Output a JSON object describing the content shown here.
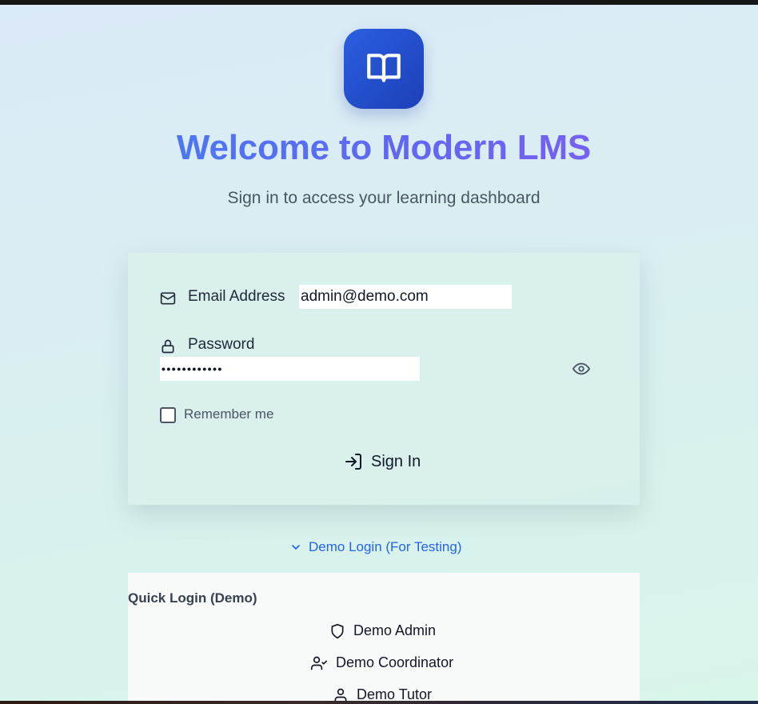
{
  "header": {
    "logo_icon": "book-open-icon",
    "title": "Welcome to Modern LMS",
    "subtitle": "Sign in to access your learning dashboard"
  },
  "form": {
    "email": {
      "icon": "mail-icon",
      "label": "Email Address",
      "value": "admin@demo.com"
    },
    "password": {
      "icon": "lock-icon",
      "label": "Password",
      "value_masked": "••••••••••••",
      "toggle_icon": "eye-icon"
    },
    "remember_label": "Remember me",
    "remember_checked": false,
    "submit": {
      "icon": "log-in-icon",
      "label": "Sign In"
    }
  },
  "demo": {
    "toggle_icon": "chevron-down-icon",
    "toggle_label": "Demo Login (For Testing)",
    "heading": "Quick Login (Demo)",
    "accounts": [
      {
        "icon": "shield-icon",
        "label": "Demo Admin"
      },
      {
        "icon": "user-check-icon",
        "label": "Demo Coordinator"
      },
      {
        "icon": "user-icon",
        "label": "Demo Tutor"
      }
    ]
  },
  "colors": {
    "brand": "#1d4ed8",
    "title_gradient_start": "#3b82f6",
    "title_gradient_end": "#8b5cf6",
    "link": "#2563eb"
  }
}
